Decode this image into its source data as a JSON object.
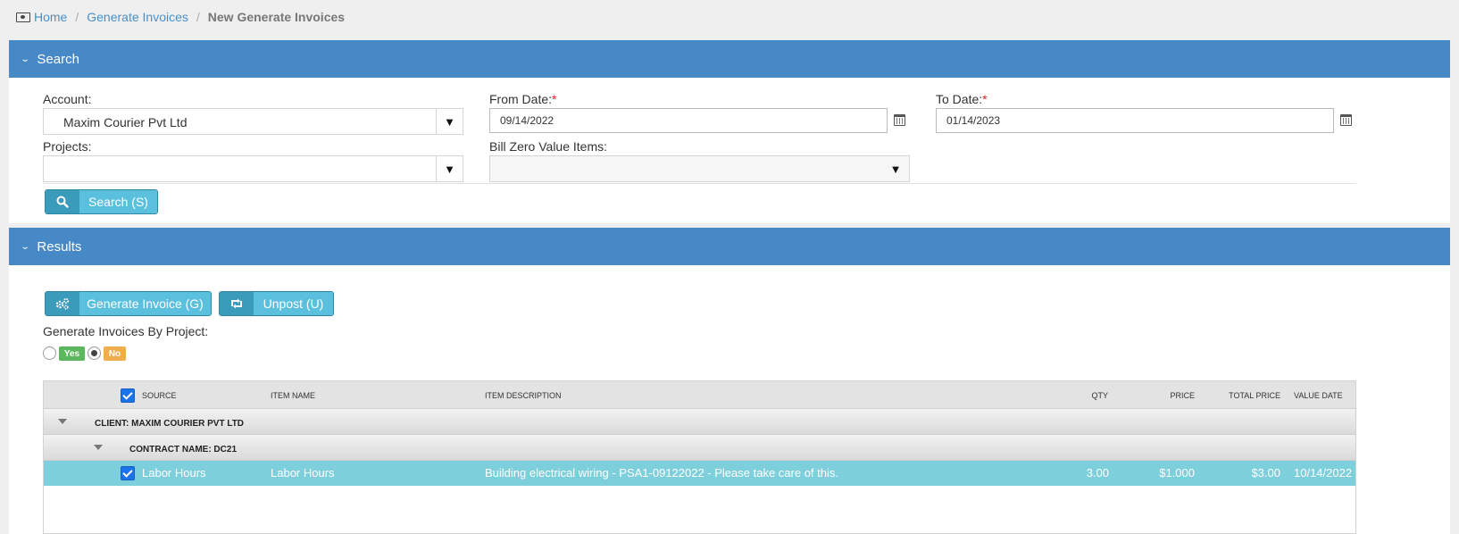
{
  "breadcrumb": {
    "home": "Home",
    "parent": "Generate Invoices",
    "current": "New Generate Invoices",
    "separator": "/"
  },
  "search_panel": {
    "title": "Search",
    "account_label": "Account:",
    "account_value": "Maxim Courier Pvt Ltd",
    "from_date_label": "From Date:",
    "from_date_value": "09/14/2022",
    "to_date_label": "To Date:",
    "to_date_value": "01/14/2023",
    "required_mark": "*",
    "projects_label": "Projects:",
    "projects_value": "",
    "bill_zero_label": "Bill Zero Value Items:",
    "bill_zero_value": "",
    "search_button": "Search (S)"
  },
  "results_panel": {
    "title": "Results",
    "generate_button": "Generate Invoice (G)",
    "unpost_button": "Unpost (U)",
    "by_project_label": "Generate Invoices By Project:",
    "yes_label": "Yes",
    "no_label": "No",
    "selected_option": "No"
  },
  "grid": {
    "columns": {
      "source": "SOURCE",
      "item_name": "ITEM NAME",
      "item_description": "ITEM DESCRIPTION",
      "qty": "QTY",
      "price": "PRICE",
      "total_price": "TOTAL PRICE",
      "value_date": "VALUE DATE"
    },
    "client_group": "CLIENT: MAXIM COURIER PVT LTD",
    "contract_group": "CONTRACT NAME: DC21",
    "rows": [
      {
        "source": "Labor Hours",
        "item_name": "Labor Hours",
        "item_description": "Building electrical wiring - PSA1-09122022 - Please take care of this.",
        "qty": "3.00",
        "price": "$1.000",
        "total_price": "$3.00",
        "value_date": "10/14/2022",
        "checked": true
      }
    ]
  },
  "colors": {
    "panel_header": "#4788c7",
    "selected_row": "#7ecfdc",
    "button_primary": "#5bc0de",
    "badge_yes": "#5cb85c",
    "badge_no": "#f0ad4e",
    "link": "#4a90c8"
  },
  "icons": {
    "breadcrumb": "money-icon",
    "search": "search-icon",
    "generate": "gears-icon",
    "unpost": "retweet-icon",
    "calendar": "calendar-icon"
  }
}
